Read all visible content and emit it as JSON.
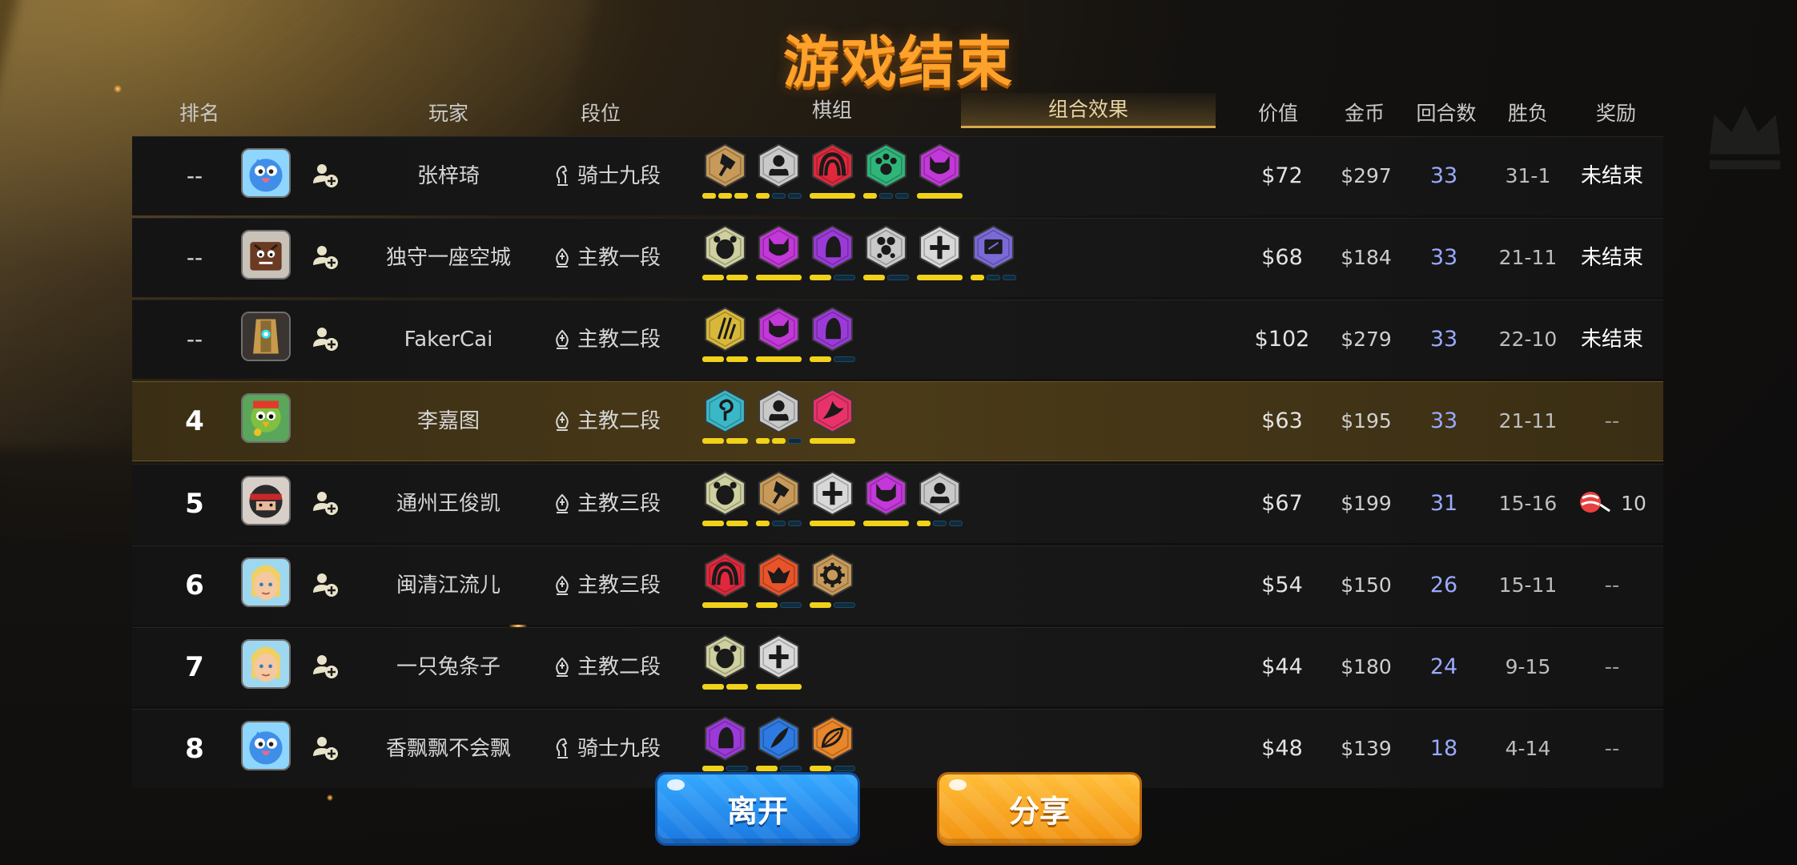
{
  "title": "游戏结束",
  "headers": {
    "rank": "排名",
    "player": "玩家",
    "tier": "段位",
    "pieces": "棋组",
    "synergy": "组合效果",
    "value": "价值",
    "gold": "金币",
    "rounds": "回合数",
    "win_loss": "胜负",
    "reward": "奖励"
  },
  "rows": [
    {
      "rank": "--",
      "name": "张梓琦",
      "tier": "骑士九段",
      "tier_icon": "knight-icon",
      "value": "$72",
      "gold": "$297",
      "rounds": "33",
      "win_loss": "31-1",
      "reward": "未结束",
      "avatar": "blue-bird",
      "synergies": [
        {
          "icon": "axe-icon",
          "color": "#c89a5a",
          "bars": [
            1,
            1,
            1
          ]
        },
        {
          "icon": "seated-icon",
          "color": "#c9c9c9",
          "bars": [
            1,
            0,
            0
          ]
        },
        {
          "icon": "arc-icon",
          "color": "#e0283c",
          "bars": [
            1
          ]
        },
        {
          "icon": "paw-icon",
          "color": "#2fb57a",
          "bars": [
            1,
            0,
            0
          ]
        },
        {
          "icon": "demon-icon",
          "color": "#c238d8",
          "bars": [
            1
          ]
        }
      ]
    },
    {
      "rank": "--",
      "name": "独守一座空城",
      "tier": "主教一段",
      "tier_icon": "bishop-icon",
      "value": "$68",
      "gold": "$184",
      "rounds": "33",
      "win_loss": "21-11",
      "reward": "未结束",
      "avatar": "box-creature",
      "synergies": [
        {
          "icon": "beast-icon",
          "color": "#cfd0a0",
          "bars": [
            1,
            1
          ]
        },
        {
          "icon": "demon-icon",
          "color": "#c238d8",
          "bars": [
            1
          ]
        },
        {
          "icon": "hooded-icon",
          "color": "#9b3ad8",
          "bars": [
            1,
            0
          ]
        },
        {
          "icon": "cluster-icon",
          "color": "#c9c9c9",
          "bars": [
            1,
            0
          ]
        },
        {
          "icon": "cross-icon",
          "color": "#d8d8d8",
          "bars": [
            1
          ]
        },
        {
          "icon": "mech-icon",
          "color": "#7a6ad8",
          "bars": [
            1,
            0,
            0
          ]
        }
      ]
    },
    {
      "rank": "--",
      "name": "FakerCai",
      "tier": "主教二段",
      "tier_icon": "bishop-icon",
      "value": "$102",
      "gold": "$279",
      "rounds": "33",
      "win_loss": "22-10",
      "reward": "未结束",
      "avatar": "golden-robot",
      "synergies": [
        {
          "icon": "claws-icon",
          "color": "#d8b83a",
          "bars": [
            1,
            1
          ]
        },
        {
          "icon": "demon-icon",
          "color": "#c238d8",
          "bars": [
            1
          ]
        },
        {
          "icon": "hooded-icon",
          "color": "#9b3ad8",
          "bars": [
            1,
            0
          ]
        }
      ]
    },
    {
      "rank": "4",
      "name": "李嘉图",
      "tier": "主教二段",
      "tier_icon": "bishop-icon",
      "value": "$63",
      "gold": "$195",
      "rounds": "33",
      "win_loss": "21-11",
      "reward": "--",
      "avatar": "green-parrot",
      "highlight": true,
      "synergies": [
        {
          "icon": "spiral-icon",
          "color": "#3ab8c8",
          "bars": [
            1,
            1
          ]
        },
        {
          "icon": "seated-icon",
          "color": "#c9c9c9",
          "bars": [
            1,
            1,
            0
          ]
        },
        {
          "icon": "dragon-icon",
          "color": "#e8336a",
          "bars": [
            1
          ]
        }
      ]
    },
    {
      "rank": "5",
      "name": "通州王俊凯",
      "tier": "主教三段",
      "tier_icon": "bishop-icon",
      "value": "$67",
      "gold": "$199",
      "rounds": "31",
      "win_loss": "15-16",
      "reward": "10",
      "reward_icon": "candy-icon",
      "avatar": "ninja",
      "synergies": [
        {
          "icon": "beast-icon",
          "color": "#cfd0a0",
          "bars": [
            1,
            1
          ]
        },
        {
          "icon": "axe-icon",
          "color": "#c89a5a",
          "bars": [
            1,
            0,
            0
          ]
        },
        {
          "icon": "cross-icon",
          "color": "#d8d8d8",
          "bars": [
            1
          ]
        },
        {
          "icon": "demon-icon",
          "color": "#c238d8",
          "bars": [
            1
          ]
        },
        {
          "icon": "seated-icon",
          "color": "#c9c9c9",
          "bars": [
            1,
            0,
            0
          ]
        }
      ]
    },
    {
      "rank": "6",
      "name": "闽清江流儿",
      "tier": "主教三段",
      "tier_icon": "bishop-icon",
      "value": "$54",
      "gold": "$150",
      "rounds": "26",
      "win_loss": "15-11",
      "reward": "--",
      "avatar": "elf",
      "synergies": [
        {
          "icon": "arc-icon",
          "color": "#e0283c",
          "bars": [
            1
          ]
        },
        {
          "icon": "goblin-icon",
          "color": "#e8542a",
          "bars": [
            1,
            0
          ]
        },
        {
          "icon": "gear-icon",
          "color": "#c89a5a",
          "bars": [
            1,
            0
          ]
        }
      ]
    },
    {
      "rank": "7",
      "name": "一只兔条子",
      "tier": "主教二段",
      "tier_icon": "bishop-icon",
      "value": "$44",
      "gold": "$180",
      "rounds": "24",
      "win_loss": "9-15",
      "reward": "--",
      "avatar": "elf",
      "synergies": [
        {
          "icon": "beast-icon",
          "color": "#cfd0a0",
          "bars": [
            1,
            1
          ]
        },
        {
          "icon": "cross-icon",
          "color": "#d8d8d8",
          "bars": [
            1
          ]
        }
      ]
    },
    {
      "rank": "8",
      "name": "香飘飘不会飘",
      "tier": "骑士九段",
      "tier_icon": "knight-icon",
      "value": "$48",
      "gold": "$139",
      "rounds": "18",
      "win_loss": "4-14",
      "reward": "--",
      "avatar": "blue-bird",
      "synergies": [
        {
          "icon": "hooded-icon",
          "color": "#9b3ad8",
          "bars": [
            1,
            0
          ]
        },
        {
          "icon": "feather-icon",
          "color": "#2f7ae0",
          "bars": [
            1,
            0
          ]
        },
        {
          "icon": "leaf-icon",
          "color": "#e8862a",
          "bars": [
            1,
            0
          ]
        }
      ]
    }
  ],
  "buttons": {
    "leave": "离开",
    "share": "分享"
  },
  "colors": {
    "title": "#ffa22b",
    "rounds": "#9aa9ff",
    "bar_on": "#f1d21a"
  }
}
